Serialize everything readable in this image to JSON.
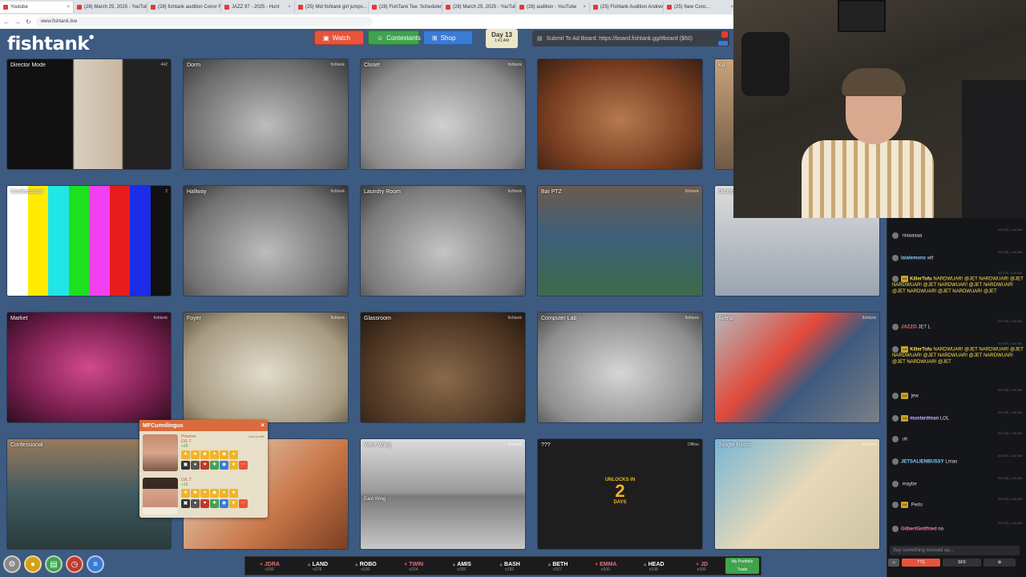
{
  "browser": {
    "tabs": [
      {
        "title": "Youtube"
      },
      {
        "title": "(28) March 25, 2025 - YouTube"
      },
      {
        "title": "(28) fishtank audition Conor Fi..."
      },
      {
        "title": "JAZZ 97 - 2025 - Hunt"
      },
      {
        "title": "(25) Mid fishtank girl jumps..."
      },
      {
        "title": "(28) FishTank Tee: Scheduler..."
      },
      {
        "title": "(28) March 25, 2025 - YouTube"
      },
      {
        "title": "(28) audition - YouTube"
      },
      {
        "title": "(25) Fishtank Audition Andrew..."
      },
      {
        "title": "(25) New Conc..."
      }
    ],
    "url": "www.fishtank.live"
  },
  "header": {
    "logo": "fishtank",
    "watch_label": "Watch",
    "contestants_label": "Contestants",
    "shop_label": "Shop",
    "day_label": "Day 13",
    "day_time": "1:41 AM",
    "ad_text": "Submit To Ad Board: https://board.fishtank.gg/#board ($50)"
  },
  "cameras": [
    {
      "name": "Director Mode",
      "count": "442"
    },
    {
      "name": "Dorm",
      "wm": "fishtank"
    },
    {
      "name": "Closet",
      "wm": "fishtank"
    },
    {
      "name": "",
      "wm": ""
    },
    {
      "name": "Kit",
      "wm": ""
    },
    {
      "name": "Confessional",
      "count": "2"
    },
    {
      "name": "Hallway",
      "wm": "fishtank"
    },
    {
      "name": "Laundry Room",
      "wm": "fishtank"
    },
    {
      "name": "Bar PTZ",
      "wm": "fishtank"
    },
    {
      "name": "Dining",
      "wm": ""
    },
    {
      "name": "Market",
      "wm": "fishtank"
    },
    {
      "name": "Foyer",
      "wm": "fishtank"
    },
    {
      "name": "Glassroom",
      "wm": "fishtank"
    },
    {
      "name": "Computer Lab",
      "wm": "fishtank"
    },
    {
      "name": "Arena",
      "wm": "fishtank"
    },
    {
      "name": "Confessional",
      "wm": ""
    },
    {
      "name": "",
      "wm": ""
    },
    {
      "name": "West Wing",
      "sub": "East Wing",
      "wm": "fishtank"
    },
    {
      "name": "???",
      "wm": "Offline",
      "unlock_top": "UNLOCKS IN",
      "unlock_num": "2",
      "unlock_bot": "DAYS"
    },
    {
      "name": "Jungle Room",
      "wm": "fishtank"
    }
  ],
  "popup": {
    "title": "MFCunnilingus",
    "close": "×",
    "players": [
      {
        "rank": "Prisoner",
        "level": "LVL 7",
        "xp": "+39",
        "link": "view profile"
      },
      {
        "rank": "",
        "level": "LVL 7",
        "xp": "+10",
        "link": ""
      }
    ]
  },
  "ticker": [
    {
      "name": "JDRA",
      "value": "¤200",
      "dir": "down"
    },
    {
      "name": "LAND",
      "value": "¤276",
      "dir": "up"
    },
    {
      "name": "ROBO",
      "value": "¤100",
      "dir": "up"
    },
    {
      "name": "TWIN",
      "value": "¤224",
      "dir": "down"
    },
    {
      "name": "AMIS",
      "value": "¤105",
      "dir": "up"
    },
    {
      "name": "BASH",
      "value": "¤192",
      "dir": "up"
    },
    {
      "name": "BETH",
      "value": "¤107",
      "dir": "up"
    },
    {
      "name": "EMMA",
      "value": "¤100",
      "dir": "down"
    },
    {
      "name": "HEAD",
      "value": "¤108",
      "dir": "up"
    },
    {
      "name": "JD",
      "value": "¤100",
      "dir": "down"
    }
  ],
  "wallet": {
    "top": "My Portfolio",
    "bottom": "Trade"
  },
  "chat": {
    "messages": [
      {
        "user": "",
        "text": "niaaaaaa",
        "ts": "3/27/25, 1:40 AM",
        "color": "#cfcfcf"
      },
      {
        "user": "lalalemons",
        "text": "wtf",
        "ts": "3/27/25, 1:40 AM",
        "color": "#7fd1ff"
      },
      {
        "user": "KillerTofu",
        "text": "NARDWUAR! @JET NARDWUAR! @JET NARDWUAR! @JET NARDWUAR! @JET NARDWUAR! @JET NARDWUAR! @JET NARDWUAR! @JET",
        "ts": "3/27/25, 1:40 AM",
        "color": "#ffe14a",
        "badge": "Lvl"
      },
      {
        "user": "JAZZO",
        "text": "JET L",
        "ts": "3/27/25, 1:40 AM",
        "color": "#e57373"
      },
      {
        "user": "KillerTofu",
        "text": "NARDWUAR! @JET NARDWUAR! @JET NARDWUAR! @JET NARDWUAR! @JET NARDWUAR! @JET NARDWUAR! @JET",
        "ts": "3/27/25, 1:40 AM",
        "color": "#ffe14a",
        "badge": "Lvl"
      },
      {
        "user": "",
        "text": "jew",
        "ts": "3/27/25, 1:40 AM",
        "color": "#cfcfcf",
        "badge": "Lvl"
      },
      {
        "user": "mustardman",
        "text": "LOL",
        "ts": "3/27/25, 1:40 AM",
        "color": "#c9b6ff",
        "badge": "Lvl"
      },
      {
        "user": "",
        "text": "uh",
        "ts": "3/27/25, 1:40 AM",
        "color": "#e57373"
      },
      {
        "user": "JETSALIENBUSSY",
        "text": "Lmao",
        "ts": "3/27/25, 1:40 AM",
        "color": "#7fd1ff"
      },
      {
        "user": "",
        "text": "maybe",
        "ts": "3/27/25, 1:40 AM",
        "color": "#e57373"
      },
      {
        "user": "",
        "text": "Pedo",
        "ts": "3/27/25, 1:40 AM",
        "color": "#e57373",
        "badge": "Lvl"
      },
      {
        "user": "GilbertGottfried",
        "text": "no",
        "ts": "3/27/25, 1:40 AM",
        "color": "#ff7aa8"
      }
    ],
    "input_placeholder": "Say something messed up...",
    "btn_tts": "TTS",
    "btn_sfx": "SFX"
  },
  "colors": {
    "bg": "#3d5a80",
    "watch": "#e8543a",
    "contestants": "#3fa34d",
    "shop": "#3b7bd6"
  }
}
